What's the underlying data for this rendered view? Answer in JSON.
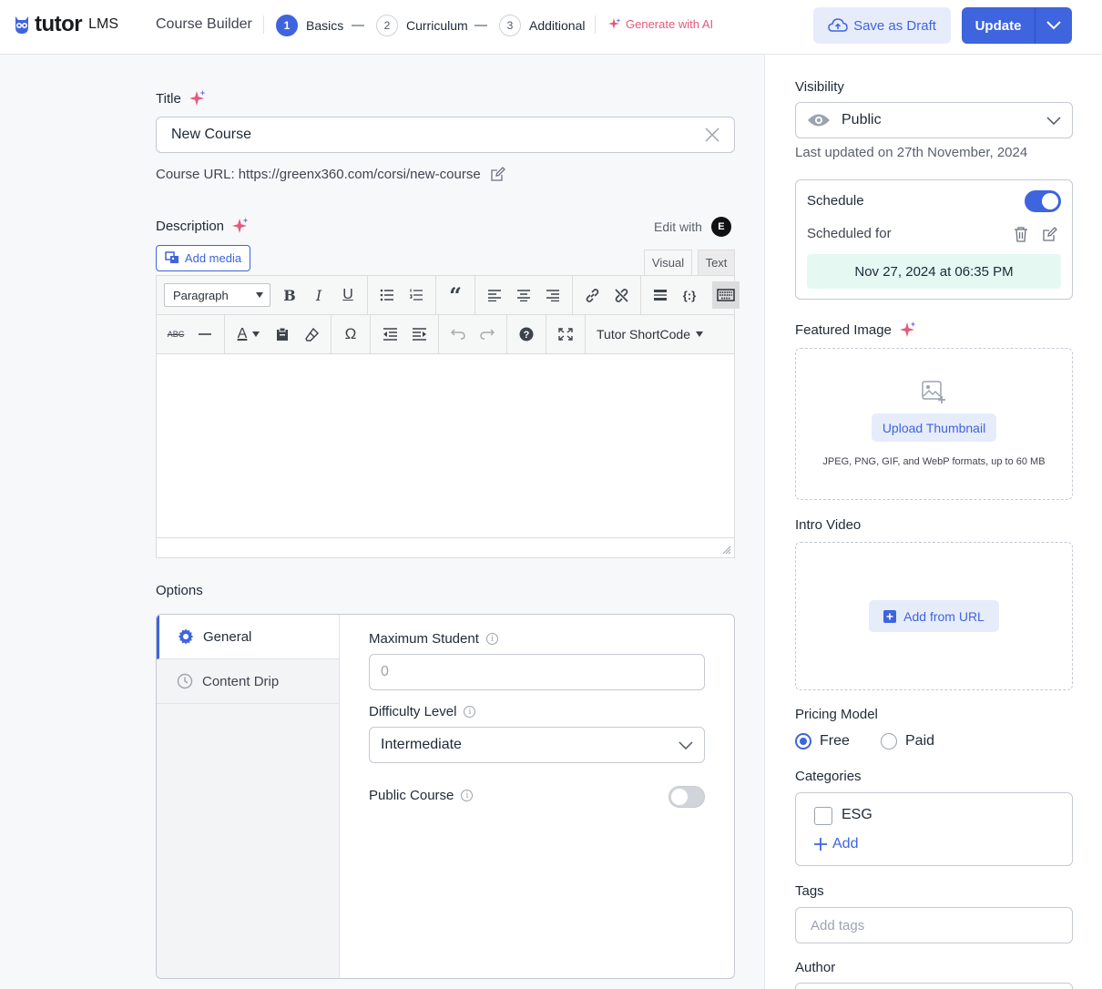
{
  "brand": {
    "name": "tutor",
    "suffix": "LMS"
  },
  "header": {
    "builder_title": "Course Builder",
    "steps": [
      {
        "num": "1",
        "label": "Basics",
        "active": true
      },
      {
        "num": "2",
        "label": "Curriculum",
        "active": false
      },
      {
        "num": "3",
        "label": "Additional",
        "active": false
      }
    ],
    "generate_ai": "Generate with AI",
    "save_draft": "Save as Draft",
    "update": "Update"
  },
  "main": {
    "title_label": "Title",
    "title_value": "New Course",
    "course_url_label": "Course URL:",
    "course_url": "https://greenx360.com/corsi/new-course",
    "description_label": "Description",
    "edit_with": "Edit with",
    "add_media": "Add media",
    "editor_tabs": {
      "visual": "Visual",
      "text": "Text"
    },
    "paragraph_select": "Paragraph",
    "shortcode": "Tutor ShortCode",
    "options_title": "Options",
    "option_tabs": [
      {
        "label": "General",
        "icon": "gear-icon",
        "active": true
      },
      {
        "label": "Content Drip",
        "icon": "clock-icon",
        "active": false
      }
    ],
    "max_student_label": "Maximum Student",
    "max_student_placeholder": "0",
    "difficulty_label": "Difficulty Level",
    "difficulty_value": "Intermediate",
    "public_course_label": "Public Course",
    "public_course_enabled": false
  },
  "sidebar": {
    "visibility_label": "Visibility",
    "visibility_value": "Public",
    "last_updated": "Last updated on 27th November, 2024",
    "schedule_label": "Schedule",
    "schedule_enabled": true,
    "scheduled_for_label": "Scheduled for",
    "scheduled_date": "Nov 27, 2024 at 06:35 PM",
    "featured_image_label": "Featured Image",
    "upload_thumbnail": "Upload Thumbnail",
    "image_formats": "JPEG, PNG, GIF, and WebP formats, up to 60 MB",
    "intro_video_label": "Intro Video",
    "add_from_url": "Add from URL",
    "pricing_label": "Pricing Model",
    "pricing_options": [
      {
        "label": "Free",
        "checked": true
      },
      {
        "label": "Paid",
        "checked": false
      }
    ],
    "categories_label": "Categories",
    "category_items": [
      {
        "label": "ESG",
        "checked": false
      }
    ],
    "add_category": "Add",
    "tags_label": "Tags",
    "tags_placeholder": "Add tags",
    "author_label": "Author"
  },
  "colors": {
    "primary": "#3e64de",
    "ai_pink": "#e5587c",
    "schedule_bg": "#e5f8f2"
  }
}
